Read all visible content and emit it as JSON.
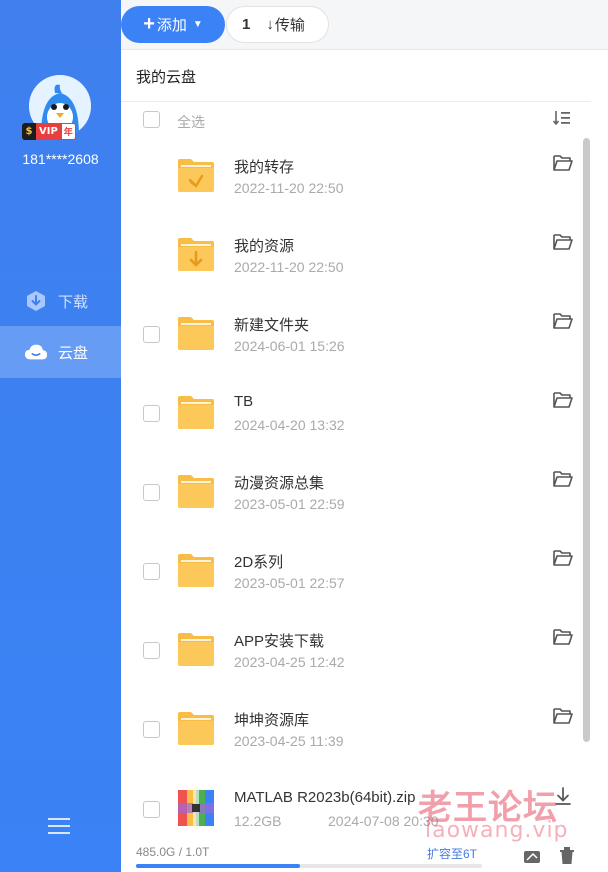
{
  "sidebar": {
    "username": "181****2608",
    "vip_badge": {
      "s": "$",
      "vip": "VIP",
      "years": "年"
    },
    "nav": [
      {
        "label": "下载",
        "icon": "download-icon"
      },
      {
        "label": "云盘",
        "icon": "cloud-icon",
        "active": true
      }
    ],
    "menu_icon": "hamburger-icon"
  },
  "toolbar": {
    "add_label": "添加",
    "transfer_count": "1",
    "transfer_label": "传输"
  },
  "breadcrumb": "我的云盘",
  "select_all_label": "全选",
  "files": [
    {
      "name": "我的转存",
      "date": "2022-11-20 22:50",
      "type": "folder-transfer",
      "checkbox": false
    },
    {
      "name": "我的资源",
      "date": "2022-11-20 22:50",
      "type": "folder-download",
      "checkbox": false
    },
    {
      "name": "新建文件夹",
      "date": "2024-06-01 15:26",
      "type": "folder",
      "checkbox": true
    },
    {
      "name": "TB",
      "date": "2024-04-20 13:32",
      "type": "folder",
      "checkbox": true
    },
    {
      "name": "动漫资源总集",
      "date": "2023-05-01 22:59",
      "type": "folder",
      "checkbox": true
    },
    {
      "name": "2D系列",
      "date": "2023-05-01 22:57",
      "type": "folder",
      "checkbox": true
    },
    {
      "name": "APP安装下载",
      "date": "2023-04-25 12:42",
      "type": "folder",
      "checkbox": true
    },
    {
      "name": "坤坤资源库",
      "date": "2023-04-25 11:39",
      "type": "folder",
      "checkbox": true
    },
    {
      "name": "MATLAB R2023b(64bit).zip",
      "size": "12.2GB",
      "date": "2024-07-08 20:30",
      "type": "zip",
      "checkbox": true
    }
  ],
  "storage": {
    "quota_text": "485.0G / 1.0T",
    "used_fraction": 0.474,
    "expand_label": "扩容至6T"
  },
  "watermark": {
    "line1": "老王论坛",
    "line2": "laowang.vip"
  },
  "colors": {
    "accent": "#3b82f6",
    "folder": "#f8bd45",
    "sidebar": "#3a82f5"
  }
}
